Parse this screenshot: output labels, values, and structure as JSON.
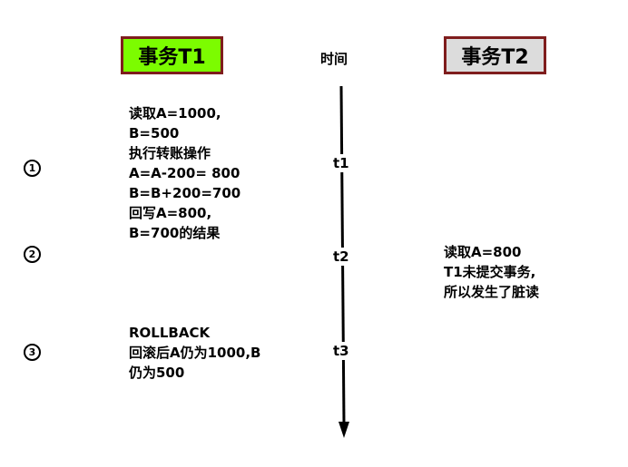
{
  "header": {
    "t1_title": "事务T1",
    "t2_title": "事务T2",
    "time_label": "时间",
    "t1_color": "#7cfc00",
    "t2_color": "#dcdcdc",
    "border_color": "#7f1d1d"
  },
  "steps": [
    "1",
    "2",
    "3"
  ],
  "ticks": [
    "t1",
    "t2",
    "t3"
  ],
  "t1": {
    "step1_lines": [
      "读取A=1000,",
      "B=500",
      "执行转账操作",
      "A=A-200= 800",
      "B=B+200=700",
      "回写A=800,",
      "B=700的结果"
    ],
    "step3_lines": [
      "ROLLBACK",
      "回滚后A仍为1000,B",
      "仍为500"
    ]
  },
  "t2": {
    "step2_lines": [
      "读取A=800",
      "T1未提交事务,",
      "所以发生了脏读"
    ]
  }
}
